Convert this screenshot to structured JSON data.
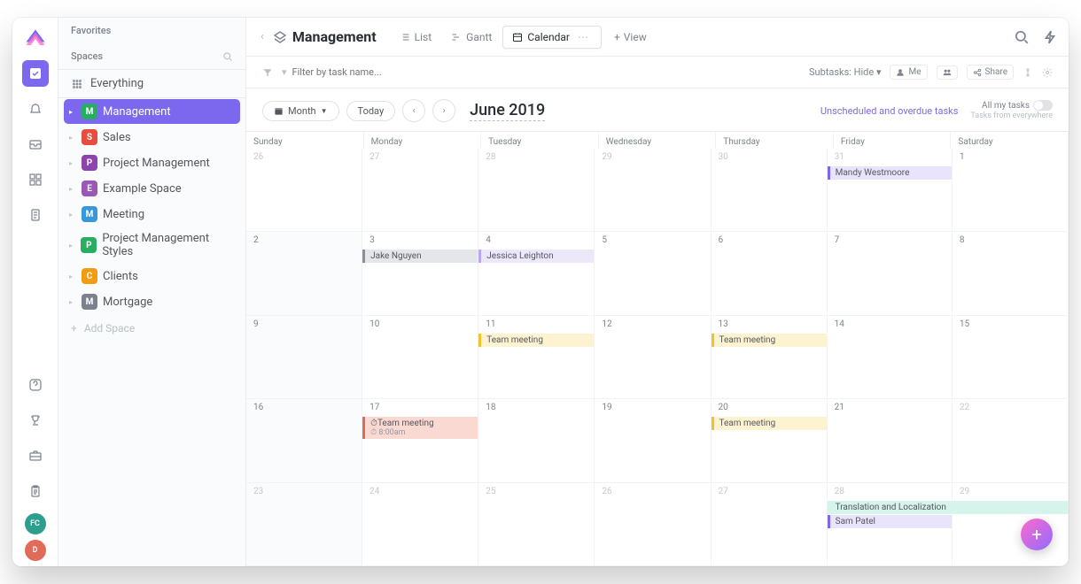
{
  "rail": {
    "avatars": [
      {
        "text": "FC",
        "color": "#2e9e8f"
      },
      {
        "text": "D",
        "color": "#e16b5a"
      }
    ]
  },
  "sidebar": {
    "favorites_label": "Favorites",
    "spaces_label": "Spaces",
    "everything_label": "Everything",
    "add_label": "Add Space",
    "items": [
      {
        "label": "Management",
        "letter": "M",
        "color": "#27ae60",
        "active": true
      },
      {
        "label": "Sales",
        "letter": "S",
        "color": "#e74c3c"
      },
      {
        "label": "Project Management",
        "letter": "P",
        "color": "#8e44ad"
      },
      {
        "label": "Example Space",
        "letter": "E",
        "color": "#9b59b6"
      },
      {
        "label": "Meeting",
        "letter": "M",
        "color": "#3498db"
      },
      {
        "label": "Project Management Styles",
        "letter": "P",
        "color": "#27ae60"
      },
      {
        "label": "Clients",
        "letter": "C",
        "color": "#f39c12"
      },
      {
        "label": "Mortgage",
        "letter": "M",
        "color": "#7c828d"
      }
    ]
  },
  "topbar": {
    "title": "Management",
    "tabs": [
      {
        "label": "List",
        "icon": "list"
      },
      {
        "label": "Gantt",
        "icon": "gantt"
      },
      {
        "label": "Calendar",
        "icon": "calendar",
        "active": true
      }
    ],
    "view_label": "View"
  },
  "filterbar": {
    "placeholder": "Filter by task name...",
    "subtasks_label": "Subtasks:",
    "subtasks_value": "Hide",
    "me_label": "Me",
    "share_label": "Share"
  },
  "controls": {
    "range_label": "Month",
    "today_label": "Today",
    "title": "June 2019",
    "unscheduled_label": "Unscheduled and overdue tasks",
    "allmy_label": "All my tasks",
    "allmy_sub": "Tasks from everywhere"
  },
  "calendar": {
    "day_labels": [
      "Sunday",
      "Monday",
      "Tuesday",
      "Wednesday",
      "Thursday",
      "Friday",
      "Saturday"
    ],
    "cells": [
      {
        "num": "26",
        "dim": true
      },
      {
        "num": "27",
        "dim": true
      },
      {
        "num": "28",
        "dim": true
      },
      {
        "num": "29",
        "dim": true
      },
      {
        "num": "30",
        "dim": true
      },
      {
        "num": "31",
        "dim": true,
        "events": [
          {
            "label": "Mandy Westmoore",
            "cls": "ev-purple"
          }
        ]
      },
      {
        "num": "1"
      },
      {
        "num": "2",
        "shade": true
      },
      {
        "num": "3",
        "events": [
          {
            "label": "Jake Nguyen",
            "cls": "ev-gray"
          }
        ]
      },
      {
        "num": "4",
        "events": [
          {
            "label": "Jessica Leighton",
            "cls": "ev-lav"
          }
        ]
      },
      {
        "num": "5"
      },
      {
        "num": "6"
      },
      {
        "num": "7"
      },
      {
        "num": "8"
      },
      {
        "num": "9",
        "shade": true
      },
      {
        "num": "10"
      },
      {
        "num": "11",
        "events": [
          {
            "label": "Team meeting",
            "cls": "ev-yellow"
          }
        ]
      },
      {
        "num": "12"
      },
      {
        "num": "13",
        "events": [
          {
            "label": "Team meeting",
            "cls": "ev-yellow"
          }
        ]
      },
      {
        "num": "14"
      },
      {
        "num": "15"
      },
      {
        "num": "16",
        "shade": true
      },
      {
        "num": "17",
        "events": [
          {
            "label": "Team meeting",
            "time": "8:00am",
            "cls": "ev-red"
          }
        ]
      },
      {
        "num": "18"
      },
      {
        "num": "19"
      },
      {
        "num": "20",
        "events": [
          {
            "label": "Team meeting",
            "cls": "ev-yellow"
          }
        ]
      },
      {
        "num": "21"
      },
      {
        "num": "22",
        "dim": true
      },
      {
        "num": "23",
        "shade": true,
        "dim": true
      },
      {
        "num": "24",
        "dim": true
      },
      {
        "num": "25",
        "dim": true
      },
      {
        "num": "26",
        "dim": true
      },
      {
        "num": "27",
        "dim": true
      },
      {
        "num": "28",
        "dim": true,
        "events": [
          {
            "label": "Translation and Localization",
            "cls": "ev-teal",
            "span": 2
          },
          {
            "label": "Sam Patel",
            "cls": "ev-purple"
          }
        ]
      },
      {
        "num": "29",
        "dim": true
      }
    ]
  }
}
